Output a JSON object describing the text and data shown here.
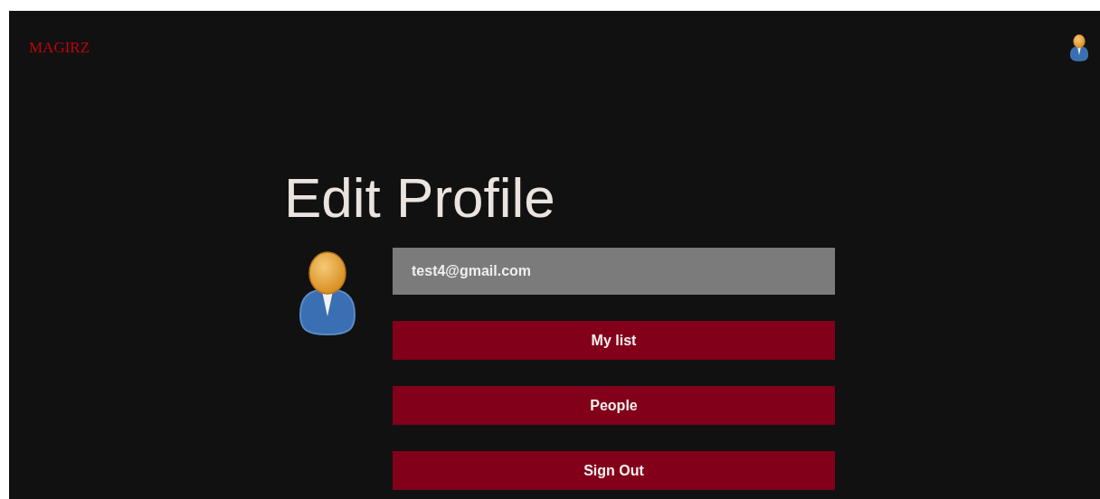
{
  "header": {
    "logo": "MAGIRZ"
  },
  "page": {
    "title": "Edit Profile",
    "email": {
      "value": "test4@gmail.com"
    },
    "buttons": [
      "My list",
      "People",
      "Sign Out"
    ]
  }
}
